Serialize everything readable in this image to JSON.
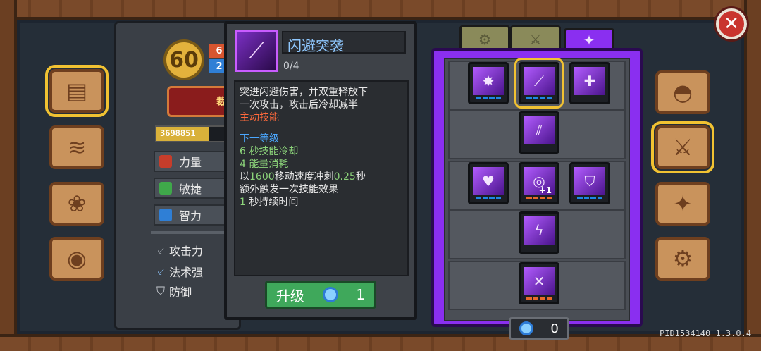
{
  "player": {
    "level": "60",
    "badge_top": "6",
    "badge_bottom": "2",
    "rank_label": "裁",
    "xp_text": "3698851",
    "xp_fraction": 0.7
  },
  "stats": [
    {
      "label": "力量",
      "icon": "fist-icon",
      "color": "#c63d2b"
    },
    {
      "label": "敏捷",
      "icon": "leaf-icon",
      "color": "#3fa84a"
    },
    {
      "label": "智力",
      "icon": "book-icon",
      "color": "#2f7fd6"
    }
  ],
  "attributes": [
    {
      "label": "攻击力",
      "icon": "sword-icon"
    },
    {
      "label": "法术强",
      "icon": "wand-icon"
    },
    {
      "label": "防御",
      "icon": "shield-icon"
    }
  ],
  "skill_detail": {
    "name": "闪避突袭",
    "level": "0/4",
    "desc_line1": "突进闪避伤害，并双重释放下",
    "desc_line2": "一次攻击，攻击后冷却减半",
    "type": "主动技能",
    "next_level_heading": "下一等级",
    "cooldown_value": "6",
    "cooldown_text": "秒技能冷却",
    "energy_value": "4",
    "energy_text": "能量消耗",
    "dash_prefix": "以",
    "dash_speed": "1600",
    "dash_mid": "移动速度冲刺",
    "dash_time": "0.25",
    "dash_suffix": "秒",
    "extra_trigger": "额外触发一次技能效果",
    "duration_value": "1",
    "duration_text": "秒持续时间",
    "upgrade_label": "升级",
    "upgrade_cost": "1"
  },
  "tree": {
    "tabs": [
      {
        "icon": "gear-tab-icon"
      },
      {
        "icon": "crossed-swords-tab-icon"
      },
      {
        "icon": "star-emblem-tab-icon"
      }
    ],
    "skill_points": "0",
    "plus_one_label": "+1"
  },
  "nav": {
    "left": [
      "book-icon",
      "treasure-map-icon",
      "paw-icon",
      "helmet-ring-icon"
    ],
    "right": [
      "helmet-icon",
      "sword-upgrade-icon",
      "compass-star-icon",
      "gear-icon"
    ]
  },
  "version": "PID1534140 1.3.0.4",
  "colors": {
    "accent_purple": "#8a2ff0",
    "upgrade_green": "#3fa85b",
    "selection_yellow": "#f1c232"
  }
}
